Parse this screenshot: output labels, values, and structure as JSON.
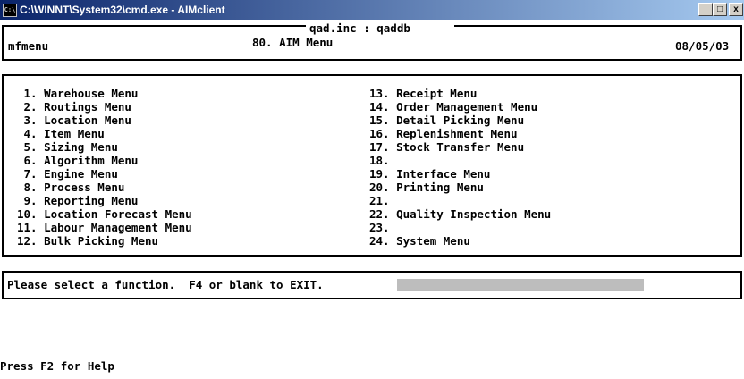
{
  "window": {
    "title": "C:\\WINNT\\System32\\cmd.exe - AIMclient",
    "icon_name": "cmd-icon",
    "icon_text": "C:\\",
    "buttons": {
      "minimize": "_",
      "maximize": "□",
      "close": "x"
    }
  },
  "header": {
    "program": "mfmenu",
    "company": "qad.inc : qaddb",
    "menu_title": "80. AIM Menu",
    "date": "08/05/03"
  },
  "menu": {
    "left": [
      " 1. Warehouse Menu",
      " 2. Routings Menu",
      " 3. Location Menu",
      " 4. Item Menu",
      " 5. Sizing Menu",
      " 6. Algorithm Menu",
      " 7. Engine Menu",
      " 8. Process Menu",
      " 9. Reporting Menu",
      "10. Location Forecast Menu",
      "11. Labour Management Menu",
      "12. Bulk Picking Menu"
    ],
    "right": [
      "13. Receipt Menu",
      "14. Order Management Menu",
      "15. Detail Picking Menu",
      "16. Replenishment Menu",
      "17. Stock Transfer Menu",
      "18.",
      "19. Interface Menu",
      "20. Printing Menu",
      "21.",
      "22. Quality Inspection Menu",
      "23.",
      "24. System Menu"
    ]
  },
  "prompt": {
    "text": "Please select a function.  F4 or blank to EXIT.",
    "input_value": ""
  },
  "status": {
    "help": "Press F2 for Help"
  }
}
